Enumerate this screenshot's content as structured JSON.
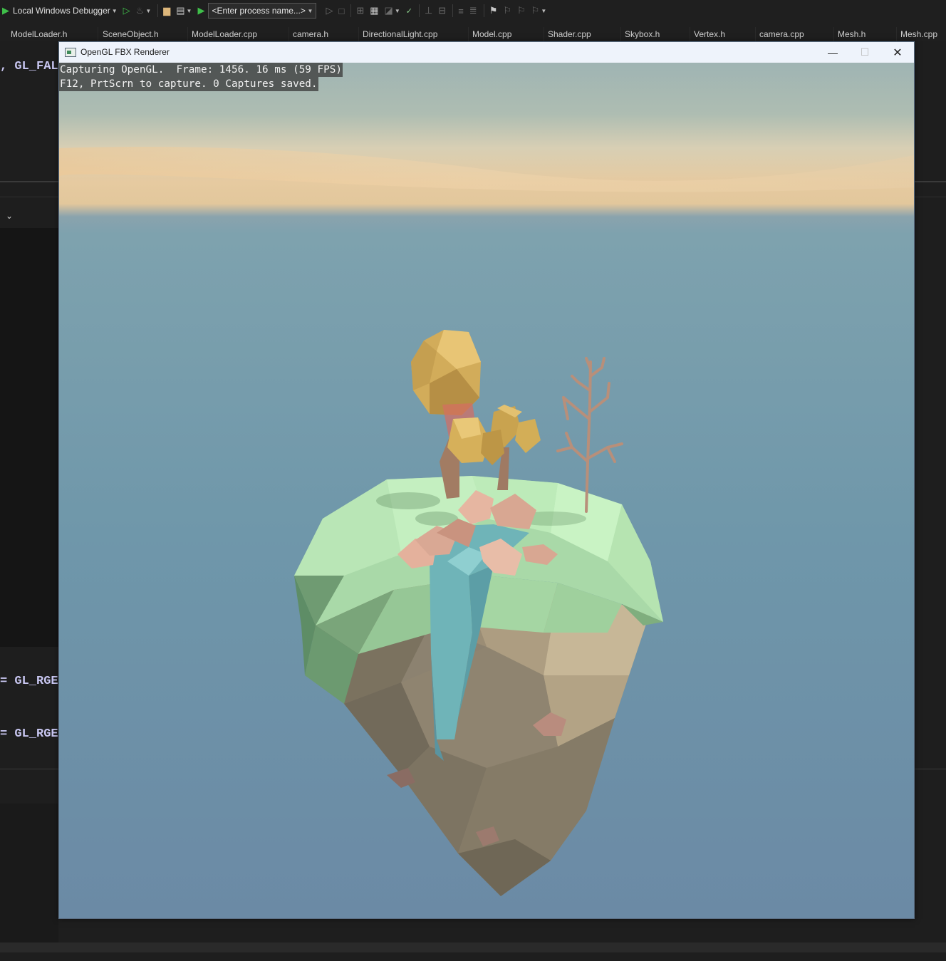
{
  "toolbar": {
    "debugger_label": "Local Windows Debugger",
    "process_placeholder": "<Enter process name...>"
  },
  "tabs": [
    "ModelLoader.h",
    "SceneObject.h",
    "ModelLoader.cpp",
    "camera.h",
    "DirectionalLight.cpp",
    "Model.cpp",
    "Shader.cpp",
    "Skybox.h",
    "Vertex.h",
    "camera.cpp",
    "Mesh.h",
    "Mesh.cpp"
  ],
  "editor": {
    "fragment_1": ", GL_FAL",
    "fragment_2": "= GL_RGE",
    "fragment_3": "= GL_RGE"
  },
  "window": {
    "title": "OpenGL FBX Renderer"
  },
  "overlay": {
    "line1": "Capturing OpenGL.  Frame: 1456. 16 ms (59 FPS)",
    "line2": "F12, PrtScrn to capture. 0 Captures saved."
  },
  "icons": {
    "play": "play-icon",
    "play_outline": "play-outline-icon",
    "minimize": "minimize-icon",
    "maximize": "maximize-icon",
    "close": "close-icon",
    "chevron": "chevron-down-icon"
  }
}
